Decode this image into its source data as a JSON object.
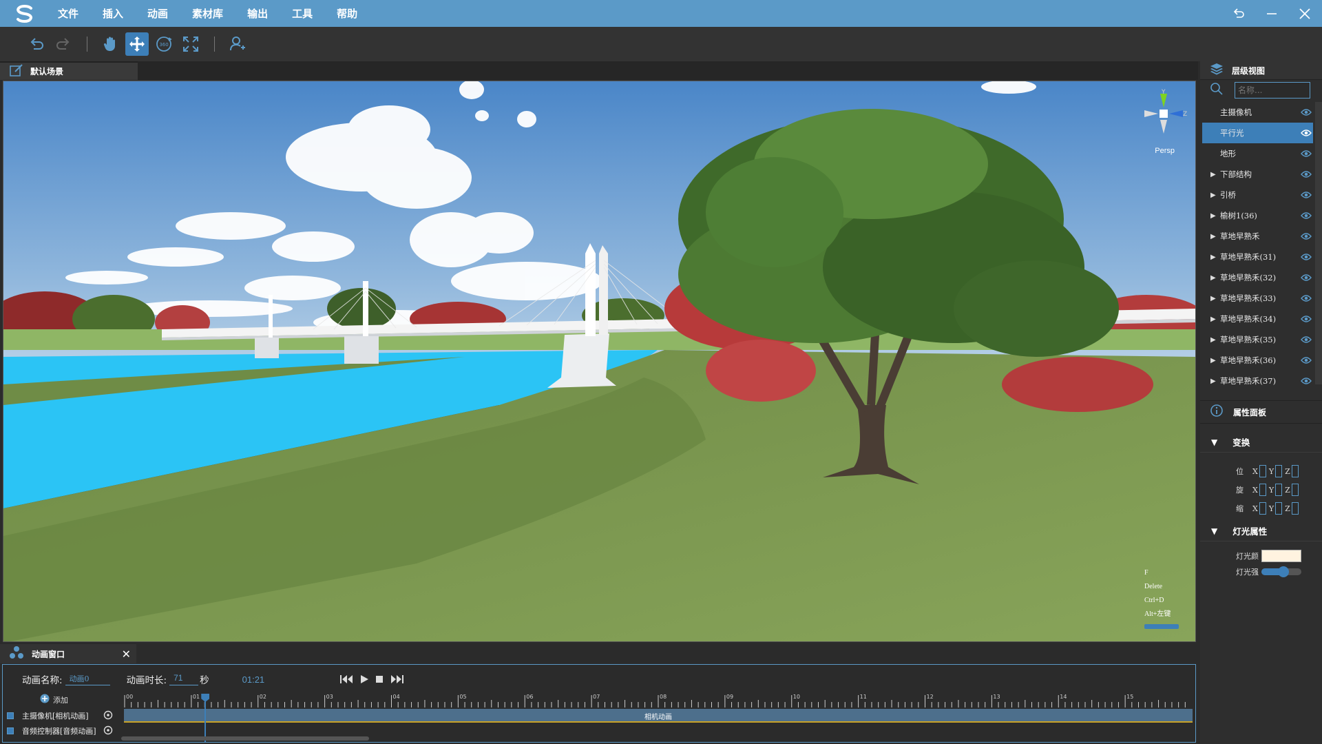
{
  "menu": {
    "items": [
      "文件",
      "插入",
      "动画",
      "素材库",
      "输出",
      "工具",
      "帮助"
    ]
  },
  "toolbar": {
    "buttons": [
      "undo-icon",
      "redo-icon",
      "hand-icon",
      "move-icon",
      "rotate-360-icon",
      "fit-view-icon",
      "add-person-icon"
    ],
    "active": "move-icon"
  },
  "scene_tab": {
    "label": "默认场景"
  },
  "viewport": {
    "gizmo_label": "Persp",
    "gizmo_axes": {
      "y": "Y",
      "z": "Z"
    },
    "shortcuts": [
      "F",
      "Delete",
      "Ctrl+D",
      "Alt+左键"
    ]
  },
  "hierarchy": {
    "title": "层级视图",
    "search_placeholder": "名称...",
    "items": [
      {
        "label": "主摄像机",
        "expandable": false,
        "selected": false
      },
      {
        "label": "平行光",
        "expandable": false,
        "selected": true
      },
      {
        "label": "地形",
        "expandable": false,
        "selected": false
      },
      {
        "label": "下部结构",
        "expandable": true,
        "selected": false
      },
      {
        "label": "引桥",
        "expandable": true,
        "selected": false
      },
      {
        "label": "榆树1(36)",
        "expandable": true,
        "selected": false
      },
      {
        "label": "草地早熟禾",
        "expandable": true,
        "selected": false
      },
      {
        "label": "草地早熟禾(31)",
        "expandable": true,
        "selected": false
      },
      {
        "label": "草地早熟禾(32)",
        "expandable": true,
        "selected": false
      },
      {
        "label": "草地早熟禾(33)",
        "expandable": true,
        "selected": false
      },
      {
        "label": "草地早熟禾(34)",
        "expandable": true,
        "selected": false
      },
      {
        "label": "草地早熟禾(35)",
        "expandable": true,
        "selected": false
      },
      {
        "label": "草地早熟禾(36)",
        "expandable": true,
        "selected": false
      },
      {
        "label": "草地早熟禾(37)",
        "expandable": true,
        "selected": false
      }
    ]
  },
  "properties": {
    "title": "属性面板",
    "transform": {
      "title": "变换",
      "rows": [
        {
          "label": "位",
          "axes": [
            "X",
            "Y",
            "Z"
          ]
        },
        {
          "label": "旋",
          "axes": [
            "X",
            "Y",
            "Z"
          ]
        },
        {
          "label": "缩",
          "axes": [
            "X",
            "Y",
            "Z"
          ]
        }
      ]
    },
    "light": {
      "title": "灯光属性",
      "color_label": "灯光颜",
      "color": "#fff3e0",
      "intensity_label": "灯光强",
      "intensity": 0.55
    }
  },
  "animation": {
    "title": "动画窗口",
    "close": "✕",
    "name_label": "动画名称:",
    "name_value": "动画0",
    "duration_label": "动画时长:",
    "duration_value": "71",
    "duration_unit": "秒",
    "current_time": "01:21",
    "add_label": "添加",
    "tracks": [
      {
        "label": "主摄像机[相机动画]",
        "clip": "相机动画"
      },
      {
        "label": "音频控制器[音频动画]",
        "clip": ""
      }
    ],
    "ruler_labels": [
      "00",
      "01",
      "02",
      "03",
      "04",
      "05",
      "06",
      "07",
      "08",
      "09",
      "10",
      "11",
      "12",
      "13",
      "14",
      "15"
    ],
    "playhead_seconds": 1.2,
    "ruler_max": 16
  },
  "colors": {
    "menubar": "#5b9ac8",
    "accent": "#3d7fb8",
    "water": "#2bc4f5",
    "grass": "#7e9a4f"
  }
}
